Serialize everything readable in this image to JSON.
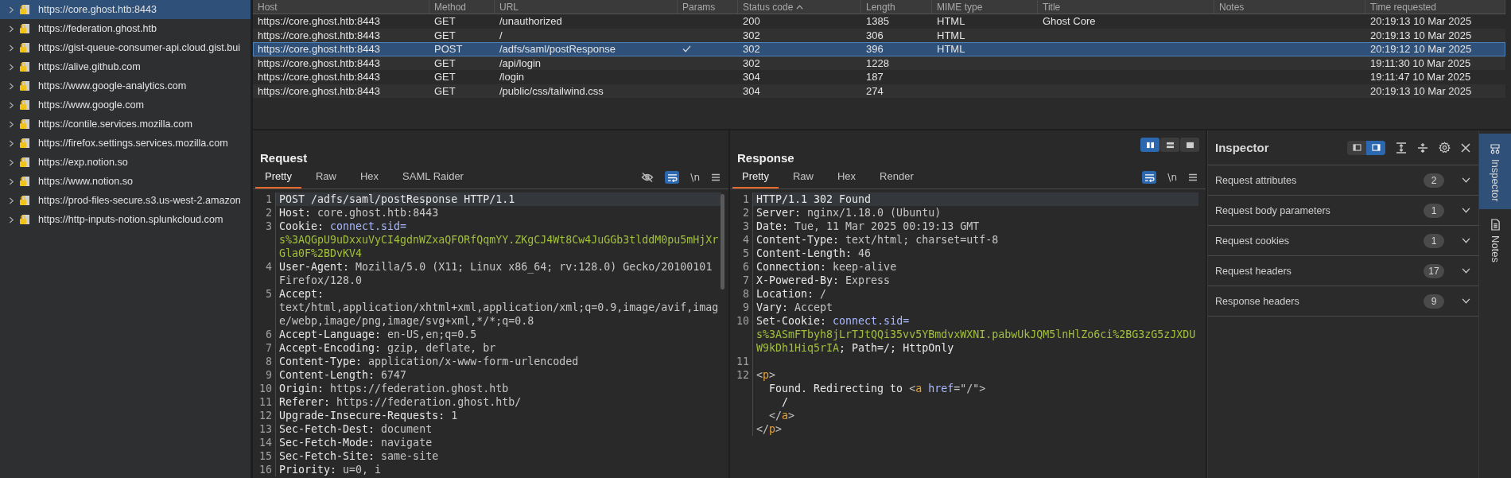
{
  "sidebar": {
    "items": [
      {
        "label": "https://core.ghost.htb:8443",
        "selected": true
      },
      {
        "label": "https://federation.ghost.htb",
        "selected": false
      },
      {
        "label": "https://gist-queue-consumer-api.cloud.gist.bui",
        "selected": false
      },
      {
        "label": "https://alive.github.com",
        "selected": false
      },
      {
        "label": "https://www.google-analytics.com",
        "selected": false
      },
      {
        "label": "https://www.google.com",
        "selected": false
      },
      {
        "label": "https://contile.services.mozilla.com",
        "selected": false
      },
      {
        "label": "https://firefox.settings.services.mozilla.com",
        "selected": false
      },
      {
        "label": "https://exp.notion.so",
        "selected": false
      },
      {
        "label": "https://www.notion.so",
        "selected": false
      },
      {
        "label": "https://prod-files-secure.s3.us-west-2.amazon",
        "selected": false
      },
      {
        "label": "https://http-inputs-notion.splunkcloud.com",
        "selected": false
      }
    ]
  },
  "table": {
    "columns": [
      {
        "label": "Host",
        "sorted": false
      },
      {
        "label": "Method",
        "sorted": false
      },
      {
        "label": "URL",
        "sorted": false
      },
      {
        "label": "Params",
        "sorted": false
      },
      {
        "label": "Status code",
        "sorted": true
      },
      {
        "label": "Length",
        "sorted": false
      },
      {
        "label": "MIME type",
        "sorted": false
      },
      {
        "label": "Title",
        "sorted": false
      },
      {
        "label": "Notes",
        "sorted": false
      },
      {
        "label": "Time requested",
        "sorted": false
      }
    ],
    "rows": [
      {
        "host": "https://core.ghost.htb:8443",
        "method": "GET",
        "url": "/unauthorized",
        "params": false,
        "status": "200",
        "length": "1385",
        "mime": "HTML",
        "title": "Ghost Core",
        "time": "20:19:13 10 Mar 2025",
        "selected": false
      },
      {
        "host": "https://core.ghost.htb:8443",
        "method": "GET",
        "url": "/",
        "params": false,
        "status": "302",
        "length": "306",
        "mime": "HTML",
        "time": "20:19:13 10 Mar 2025",
        "selected": false
      },
      {
        "host": "https://core.ghost.htb:8443",
        "method": "POST",
        "url": "/adfs/saml/postResponse",
        "params": true,
        "status": "302",
        "length": "396",
        "mime": "HTML",
        "time": "20:19:12 10 Mar 2025",
        "selected": true
      },
      {
        "host": "https://core.ghost.htb:8443",
        "method": "GET",
        "url": "/api/login",
        "params": false,
        "status": "302",
        "length": "1228",
        "time": "19:11:30 10 Mar 2025",
        "selected": false
      },
      {
        "host": "https://core.ghost.htb:8443",
        "method": "GET",
        "url": "/login",
        "params": false,
        "status": "304",
        "length": "187",
        "time": "19:11:47 10 Mar 2025",
        "selected": false
      },
      {
        "host": "https://core.ghost.htb:8443",
        "method": "GET",
        "url": "/public/css/tailwind.css",
        "params": false,
        "status": "304",
        "length": "274",
        "time": "20:19:13 10 Mar 2025",
        "selected": false
      }
    ]
  },
  "view_buttons": [
    {
      "kind": "columns",
      "selected": true
    },
    {
      "kind": "rows",
      "selected": false
    },
    {
      "kind": "single",
      "selected": false
    }
  ],
  "request": {
    "title": "Request",
    "tabs": [
      {
        "label": "Pretty",
        "selected": true
      },
      {
        "label": "Raw",
        "selected": false
      },
      {
        "label": "Hex",
        "selected": false
      },
      {
        "label": "SAML Raider",
        "selected": false
      }
    ],
    "hide_toggle": true,
    "wrap_on": true,
    "newline_label": "\\n",
    "lines": [
      {
        "num": "1",
        "current": true,
        "parts": [
          {
            "text": "POST /adfs/saml/postResponse HTTP/1.1",
            "kind": "name"
          }
        ]
      },
      {
        "num": "2",
        "current": false,
        "parts": [
          {
            "text": "Host: ",
            "kind": "name"
          },
          {
            "text": "core.ghost.htb:8443",
            "kind": "value"
          }
        ]
      },
      {
        "num": "3",
        "current": false,
        "parts": [
          {
            "text": "Cookie: ",
            "kind": "name"
          },
          {
            "text": "connect.sid=",
            "kind": "attr"
          },
          {
            "text": "s%3AQGpU9uDxxuVyCI4gdnWZxaQFORfQqmYY.ZKgCJ4Wt8Cw4JuGGb3tlddM0pu5mHjXrGla0F%2BDvKV4",
            "kind": "token"
          }
        ]
      },
      {
        "num": "4",
        "current": false,
        "parts": [
          {
            "text": "User-Agent: ",
            "kind": "name"
          },
          {
            "text": "Mozilla/5.0 (X11; Linux x86_64; rv:128.0) Gecko/20100101 Firefox/128.0",
            "kind": "value"
          }
        ]
      },
      {
        "num": "5",
        "current": false,
        "parts": [
          {
            "text": "Accept: ",
            "kind": "name"
          },
          {
            "text": "text/html,application/xhtml+xml,application/xml;q=0.9,image/avif,image/webp,image/png,image/svg+xml,*/*;q=0.8",
            "kind": "value"
          }
        ]
      },
      {
        "num": "6",
        "current": false,
        "parts": [
          {
            "text": "Accept-Language: ",
            "kind": "name"
          },
          {
            "text": "en-US,en;q=0.5",
            "kind": "value"
          }
        ]
      },
      {
        "num": "7",
        "current": false,
        "parts": [
          {
            "text": "Accept-Encoding: ",
            "kind": "name"
          },
          {
            "text": "gzip, deflate, br",
            "kind": "value"
          }
        ]
      },
      {
        "num": "8",
        "current": false,
        "parts": [
          {
            "text": "Content-Type: ",
            "kind": "name"
          },
          {
            "text": "application/x-www-form-urlencoded",
            "kind": "value"
          }
        ]
      },
      {
        "num": "9",
        "current": false,
        "parts": [
          {
            "text": "Content-Length: ",
            "kind": "name"
          },
          {
            "text": "6747",
            "kind": "value"
          }
        ]
      },
      {
        "num": "10",
        "current": false,
        "parts": [
          {
            "text": "Origin: ",
            "kind": "name"
          },
          {
            "text": "https://federation.ghost.htb",
            "kind": "value"
          }
        ]
      },
      {
        "num": "11",
        "current": false,
        "parts": [
          {
            "text": "Referer: ",
            "kind": "name"
          },
          {
            "text": "https://federation.ghost.htb/",
            "kind": "value"
          }
        ]
      },
      {
        "num": "12",
        "current": false,
        "parts": [
          {
            "text": "Upgrade-Insecure-Requests: ",
            "kind": "name"
          },
          {
            "text": "1",
            "kind": "value"
          }
        ]
      },
      {
        "num": "13",
        "current": false,
        "parts": [
          {
            "text": "Sec-Fetch-Dest: ",
            "kind": "name"
          },
          {
            "text": "document",
            "kind": "value"
          }
        ]
      },
      {
        "num": "14",
        "current": false,
        "parts": [
          {
            "text": "Sec-Fetch-Mode: ",
            "kind": "name"
          },
          {
            "text": "navigate",
            "kind": "value"
          }
        ]
      },
      {
        "num": "15",
        "current": false,
        "parts": [
          {
            "text": "Sec-Fetch-Site: ",
            "kind": "name"
          },
          {
            "text": "same-site",
            "kind": "value"
          }
        ]
      },
      {
        "num": "16",
        "current": false,
        "parts": [
          {
            "text": "Priority: ",
            "kind": "name"
          },
          {
            "text": "u=0, i",
            "kind": "value"
          }
        ]
      }
    ]
  },
  "response": {
    "title": "Response",
    "tabs": [
      {
        "label": "Pretty",
        "selected": true
      },
      {
        "label": "Raw",
        "selected": false
      },
      {
        "label": "Hex",
        "selected": false
      },
      {
        "label": "Render",
        "selected": false
      }
    ],
    "wrap_on": true,
    "newline_label": "\\n",
    "lines": [
      {
        "num": "1",
        "current": true,
        "parts": [
          {
            "text": "HTTP/1.1 302 Found",
            "kind": "name"
          }
        ]
      },
      {
        "num": "2",
        "current": false,
        "parts": [
          {
            "text": "Server: ",
            "kind": "name"
          },
          {
            "text": "nginx/1.18.0 (Ubuntu)",
            "kind": "value"
          }
        ]
      },
      {
        "num": "3",
        "current": false,
        "parts": [
          {
            "text": "Date: ",
            "kind": "name"
          },
          {
            "text": "Tue, 11 Mar 2025 00:19:13 GMT",
            "kind": "value"
          }
        ]
      },
      {
        "num": "4",
        "current": false,
        "parts": [
          {
            "text": "Content-Type: ",
            "kind": "name"
          },
          {
            "text": "text/html; charset=utf-8",
            "kind": "value"
          }
        ]
      },
      {
        "num": "5",
        "current": false,
        "parts": [
          {
            "text": "Content-Length: ",
            "kind": "name"
          },
          {
            "text": "46",
            "kind": "value"
          }
        ]
      },
      {
        "num": "6",
        "current": false,
        "parts": [
          {
            "text": "Connection: ",
            "kind": "name"
          },
          {
            "text": "keep-alive",
            "kind": "value"
          }
        ]
      },
      {
        "num": "7",
        "current": false,
        "parts": [
          {
            "text": "X-Powered-By: ",
            "kind": "name"
          },
          {
            "text": "Express",
            "kind": "value"
          }
        ]
      },
      {
        "num": "8",
        "current": false,
        "parts": [
          {
            "text": "Location: ",
            "kind": "name"
          },
          {
            "text": "/",
            "kind": "value"
          }
        ]
      },
      {
        "num": "9",
        "current": false,
        "parts": [
          {
            "text": "Vary: ",
            "kind": "name"
          },
          {
            "text": "Accept",
            "kind": "value"
          }
        ]
      },
      {
        "num": "10",
        "current": false,
        "parts": [
          {
            "text": "Set-Cookie: ",
            "kind": "name"
          },
          {
            "text": "connect.sid=",
            "kind": "attr"
          },
          {
            "text": "s%3ASmFTbyh8jLrTJtQQi35vv5YBmdvxWXNI.pabwUkJQM5lnHlZo6ci%2BG3zG5zJXDUW9kDh1Hiq5rIA",
            "kind": "token"
          },
          {
            "text": "; Path=/; HttpOnly",
            "kind": "name"
          }
        ]
      },
      {
        "num": "11",
        "current": false
      },
      {
        "num": "12",
        "current": false,
        "parts": [
          {
            "text": "<",
            "kind": "punct"
          },
          {
            "text": "p",
            "kind": "tag"
          },
          {
            "text": ">",
            "kind": "punct"
          }
        ]
      },
      {
        "current": false,
        "parts": [
          {
            "text": "  Found. Redirecting to ",
            "kind": "name"
          },
          {
            "text": "<",
            "kind": "punct"
          },
          {
            "text": "a",
            "kind": "tag"
          },
          {
            "text": " href",
            "kind": "attr"
          },
          {
            "text": "=\"/\">",
            "kind": "punct"
          }
        ]
      },
      {
        "current": false,
        "parts": [
          {
            "text": "    /",
            "kind": "name"
          }
        ]
      },
      {
        "current": false,
        "parts": [
          {
            "text": "  </",
            "kind": "punct"
          },
          {
            "text": "a",
            "kind": "tag"
          },
          {
            "text": ">",
            "kind": "punct"
          }
        ]
      },
      {
        "current": false,
        "parts": [
          {
            "text": "</",
            "kind": "punct"
          },
          {
            "text": "p",
            "kind": "tag"
          },
          {
            "text": ">",
            "kind": "punct"
          }
        ]
      }
    ]
  },
  "inspector": {
    "title": "Inspector",
    "layout": [
      {
        "kind": "left",
        "selected": false
      },
      {
        "kind": "right",
        "selected": true
      }
    ],
    "sections": [
      {
        "label": "Request attributes",
        "count": "2",
        "expanded": false
      },
      {
        "label": "Request body parameters",
        "count": "1",
        "expanded": false
      },
      {
        "label": "Request cookies",
        "count": "1",
        "expanded": false
      },
      {
        "label": "Request headers",
        "count": "17",
        "expanded": false
      },
      {
        "label": "Response headers",
        "count": "9",
        "expanded": false
      }
    ]
  },
  "side_tabs": [
    {
      "label": "Inspector",
      "kind": "inspector",
      "selected": true
    },
    {
      "label": "Notes",
      "kind": "notes",
      "selected": false
    }
  ]
}
